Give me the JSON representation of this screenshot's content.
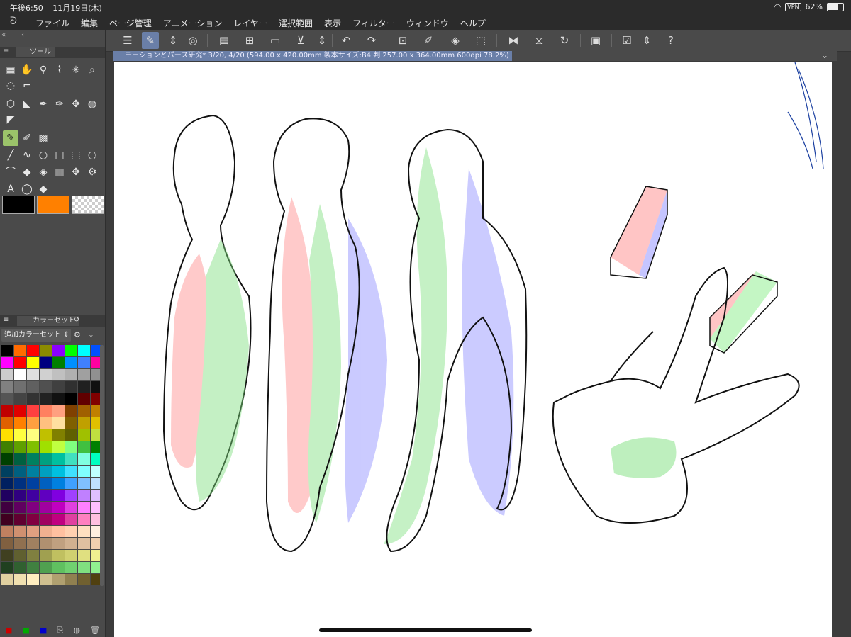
{
  "status": {
    "time": "午後6:50",
    "date": "11月19日(木)",
    "vpn": "VPN",
    "battery": "62%"
  },
  "menu": [
    "ファイル",
    "編集",
    "ページ管理",
    "アニメーション",
    "レイヤー",
    "選択範囲",
    "表示",
    "フィルター",
    "ウィンドウ",
    "ヘルプ"
  ],
  "panels": {
    "tool_tab": "ツール",
    "colorset_tab": "カラーセット",
    "colorset_select": "追加カラーセット"
  },
  "document": {
    "tab_title": "モーションとパース研究* 3/20, 4/20 (594.00 x 420.00mm 製本サイズ:B4 判 257.00 x 364.00mm 600dpi 78.2%)"
  },
  "colors": {
    "main": "#000000",
    "sub": "#ff8000",
    "palette": [
      "#000000",
      "#ff6a00",
      "#ff0000",
      "#8b8b00",
      "#8b00ff",
      "#00ff00",
      "#00ffff",
      "#0050ff",
      "#ff00ff",
      "#ff0000",
      "#ffff00",
      "#000080",
      "#008000",
      "#0090ff",
      "#4080ff",
      "#ff00a0",
      "#cccccc",
      "#ffffff",
      "#e0e0e0",
      "#d0d0d0",
      "#c0c0c0",
      "#b0b0b0",
      "#a0a0a0",
      "#909090",
      "#808080",
      "#707070",
      "#606060",
      "#505050",
      "#404040",
      "#303030",
      "#202020",
      "#101010",
      "#555555",
      "#444444",
      "#333333",
      "#222222",
      "#111111",
      "#000000",
      "#600000",
      "#800000",
      "#c00000",
      "#e00000",
      "#ff4040",
      "#ff8060",
      "#ffa080",
      "#804000",
      "#a06000",
      "#c08000",
      "#e06000",
      "#ff8000",
      "#ffa040",
      "#ffc080",
      "#ffe0a0",
      "#806000",
      "#c0a000",
      "#e0c000",
      "#ffe000",
      "#ffff40",
      "#ffff80",
      "#c0c000",
      "#808000",
      "#606000",
      "#a0c000",
      "#c0e040",
      "#408000",
      "#60a000",
      "#80c000",
      "#a0e000",
      "#c0ff40",
      "#80ff80",
      "#40c040",
      "#008000",
      "#004000",
      "#006040",
      "#008060",
      "#00a080",
      "#00c0a0",
      "#40e0c0",
      "#80ffe0",
      "#00ffc0",
      "#004060",
      "#006080",
      "#0080a0",
      "#00a0c0",
      "#00c0e0",
      "#40e0ff",
      "#80ffff",
      "#c0ffff",
      "#002060",
      "#003080",
      "#0040a0",
      "#0060c0",
      "#0080e0",
      "#40a0ff",
      "#80c0ff",
      "#c0e0ff",
      "#200060",
      "#300080",
      "#4000a0",
      "#6000c0",
      "#8000e0",
      "#a040ff",
      "#c080ff",
      "#e0c0ff",
      "#400040",
      "#600060",
      "#800080",
      "#a000a0",
      "#c000c0",
      "#e040e0",
      "#ff80ff",
      "#ffc0ff",
      "#400020",
      "#600030",
      "#800040",
      "#a00060",
      "#c00080",
      "#e040a0",
      "#ff80c0",
      "#ffc0e0",
      "#c08060",
      "#d09070",
      "#e0a080",
      "#f0b090",
      "#ffc0a0",
      "#ffd0b0",
      "#ffe0c0",
      "#fff0e0",
      "#806040",
      "#907050",
      "#a08060",
      "#b09070",
      "#c0a080",
      "#d0b090",
      "#e0c0a0",
      "#f0d0b0",
      "#404020",
      "#606030",
      "#808040",
      "#a0a050",
      "#c0c060",
      "#d0d070",
      "#e0e080",
      "#f0f090",
      "#204020",
      "#306030",
      "#408040",
      "#50a050",
      "#60c060",
      "#70d070",
      "#80e080",
      "#90f090",
      "#e0d0a0",
      "#f0e0b0",
      "#ffeec0",
      "#d0c090",
      "#b0a070",
      "#908050",
      "#706030",
      "#504010"
    ]
  },
  "toolbar_icons": [
    "menu-icon",
    "layer-property-icon",
    "chevron-updown-icon",
    "spiral-icon",
    "new-canvas-icon",
    "add-page-icon",
    "open-folder-icon",
    "save-icon",
    "chevron-updown-icon",
    "undo-icon",
    "redo-icon",
    "transform-icon",
    "pen-adjust-icon",
    "fill-icon",
    "select-all-icon",
    "flip-horizontal-icon",
    "flip-vertical-icon",
    "rotate-icon",
    "border-icon",
    "checkmark-icon",
    "chevron-updown-icon",
    "help-icon"
  ],
  "tool_icons": [
    "layout-icon",
    "hand-icon",
    "zoom-icon",
    "eyedrop-icon",
    "magic-wand-icon",
    "auto-select-icon",
    "lasso-icon",
    "object-select-icon",
    "cube-icon",
    "ruler-icon",
    "pen-icon",
    "marker-icon",
    "airbrush-icon",
    "blend-icon",
    "ruler-edge-icon",
    "pencil-selected-icon",
    "pencil-icon",
    "pattern-icon",
    "line-icon",
    "curve-icon",
    "ellipse-icon",
    "rect-icon",
    "marquee-icon",
    "circle-select-icon",
    "lasso-select-icon",
    "fill-bucket-icon",
    "fill-icon",
    "gradient-icon",
    "move-icon",
    "warp-icon",
    "text-icon",
    "balloon-icon",
    "eraser-icon"
  ]
}
